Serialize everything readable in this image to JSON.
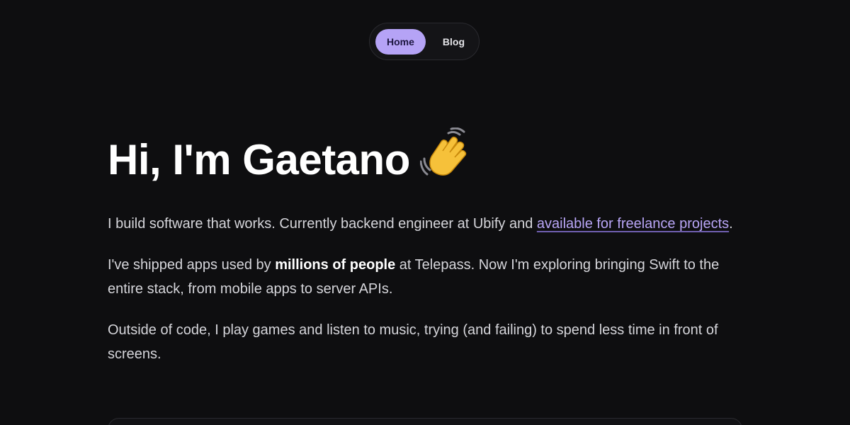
{
  "nav": {
    "items": [
      {
        "label": "Home",
        "active": true
      },
      {
        "label": "Blog",
        "active": false
      }
    ]
  },
  "hero": {
    "title": "Hi, I'm Gaetano",
    "emoji_icon": "waving-hand-icon"
  },
  "about": {
    "p1_text": "I build software that works. Currently backend engineer at Ubify and ",
    "p1_link": "available for freelance projects",
    "p1_end": ".",
    "p2_before": "I've shipped apps used by ",
    "p2_bold": "millions of people",
    "p2_after": " at Telepass. Now I'm exploring bringing Swift to the entire stack, from mobile apps to server APIs.",
    "p3_text": "Outside of code, I play games and listen to music, trying (and failing) to spend less time in front of screens."
  },
  "colors": {
    "background": "#0e0e10",
    "accent": "#b5a3f6",
    "link": "#b9a6f7"
  }
}
